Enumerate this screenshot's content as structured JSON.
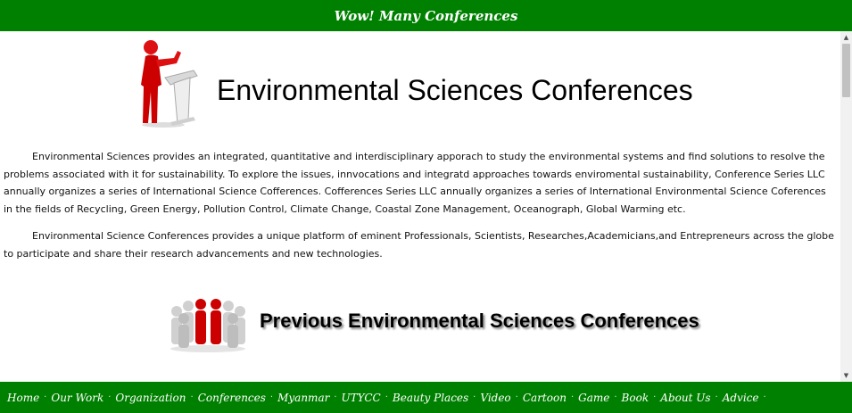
{
  "header": {
    "title": "Wow! Many Conferences"
  },
  "hero": {
    "title": "Environmental Sciences Conferences"
  },
  "paragraphs": [
    "Environmental Sciences provides an integrated, quantitative and interdisciplinary apporach to study the environmental systems and find solutions to resolve the problems associated with it for sustainability. To explore the issues, innvocations and integratd approaches towards enviromental sustainability, Conference Series LLC annually organizes a series of International Science Cofferences. Cofferences Series LLC annually organizes a series of International Environmental Science Coferences in the fields of Recycling, Green Energy, Pollution Control, Climate Change, Coastal Zone Management, Oceanograph, Global Warming etc.",
    "Environmental Science Conferences provides a unique platform of eminent Professionals, Scientists, Researches,Academicians,and Entrepreneurs across the globe to participate and share their research advancements and new technologies."
  ],
  "previous": {
    "title": "Previous Environmental Sciences Conferences"
  },
  "nav": [
    "Home",
    "Our Work",
    "Organization",
    "Conferences",
    "Myanmar",
    "UTYCC",
    "Beauty Places",
    "Video",
    "Cartoon",
    "Game",
    "Book",
    "About Us",
    "Advice"
  ],
  "nav_separator": "·",
  "colors": {
    "green": "#008000"
  }
}
